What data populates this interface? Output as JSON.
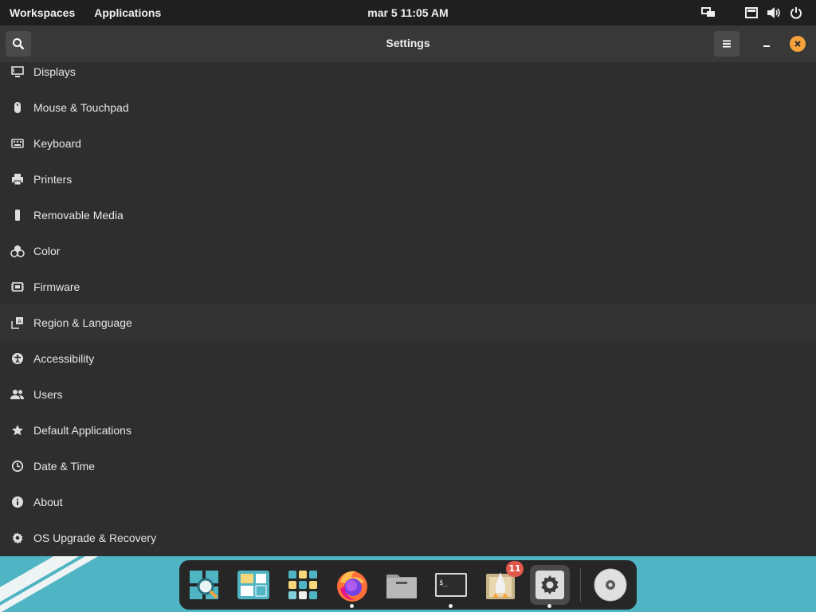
{
  "top_panel": {
    "workspaces": "Workspaces",
    "applications": "Applications",
    "clock": "mar 5  11:05 AM",
    "tray_icons": [
      "display-icon",
      "notification-icon",
      "volume-icon",
      "power-icon"
    ]
  },
  "window": {
    "title": "Settings",
    "header_icons": [
      "search-icon",
      "hamburger-menu-icon",
      "minimize-icon",
      "close-icon"
    ],
    "accent_color": "#f6a23a"
  },
  "settings_list": {
    "items": [
      {
        "label": "Displays",
        "icon": "display-icon"
      },
      {
        "label": "Mouse & Touchpad",
        "icon": "mouse-icon"
      },
      {
        "label": "Keyboard",
        "icon": "keyboard-icon"
      },
      {
        "label": "Printers",
        "icon": "printer-icon"
      },
      {
        "label": "Removable Media",
        "icon": "usb-media-icon"
      },
      {
        "label": "Color",
        "icon": "color-icon"
      },
      {
        "label": "Firmware",
        "icon": "chip-icon"
      },
      {
        "label": "Region & Language",
        "icon": "language-icon",
        "selected": true
      },
      {
        "label": "Accessibility",
        "icon": "accessibility-icon"
      },
      {
        "label": "Users",
        "icon": "users-icon"
      },
      {
        "label": "Default Applications",
        "icon": "star-icon"
      },
      {
        "label": "Date & Time",
        "icon": "clock-icon"
      },
      {
        "label": "About",
        "icon": "info-icon"
      },
      {
        "label": "OS Upgrade & Recovery",
        "icon": "upgrade-icon"
      }
    ]
  },
  "dock": {
    "items": [
      {
        "name": "search-app-icon",
        "running": false
      },
      {
        "name": "workspaces-app-icon",
        "running": false
      },
      {
        "name": "app-grid-icon",
        "running": false
      },
      {
        "name": "firefox-icon",
        "running": true
      },
      {
        "name": "files-icon",
        "running": false
      },
      {
        "name": "terminal-icon",
        "running": true
      },
      {
        "name": "pop-shop-icon",
        "running": false
      },
      {
        "name": "settings-gear-icon",
        "running": true
      },
      {
        "name": "optical-disc-icon",
        "running": false
      }
    ],
    "shop_badge": "11"
  }
}
